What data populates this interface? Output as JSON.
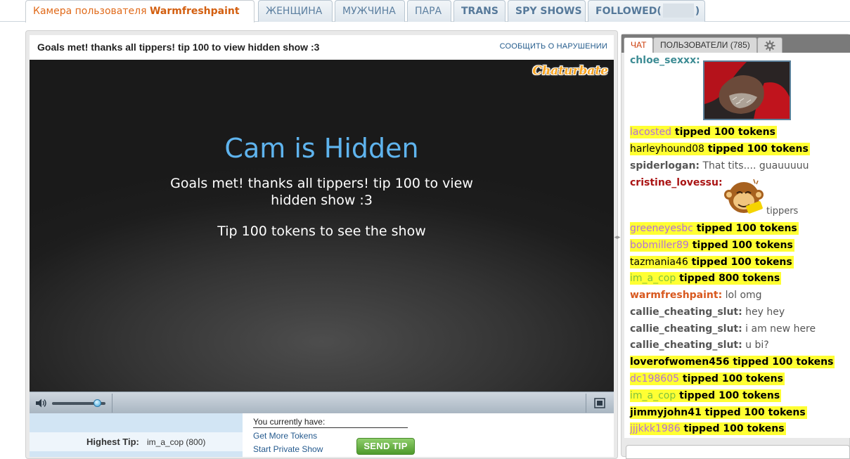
{
  "tabs": {
    "cam_prefix": "Камера пользователя",
    "cam_user": "Warmfreshpaint",
    "female": "ЖЕНЩИНА",
    "male": "МУЖЧИНА",
    "couple": "ПАРА",
    "trans": "TRANS",
    "spy": "SPY SHOWS",
    "followed_prefix": "FOLLOWED(",
    "followed_suffix": ")"
  },
  "room": {
    "subject": "Goals met! thanks all tippers! tip 100 to view hidden show :3",
    "report_link": "СООБЩИТЬ О НАРУШЕНИИ"
  },
  "video": {
    "logo": "Chaturbate",
    "hidden_title": "Cam is Hidden",
    "hidden_message": "Goals met! thanks all tippers! tip 100 to view hidden show :3",
    "tip_prompt": "Tip 100 tokens to see the show",
    "volume_level": 0.85
  },
  "info": {
    "highest_tip_label": "Highest Tip:",
    "highest_tip_value": "im_a_cop (800)"
  },
  "tip": {
    "balance_label": "You currently have:",
    "get_more": "Get More Tokens",
    "private_show": "Start Private Show",
    "send_tip": "SEND TIP"
  },
  "chat": {
    "tab_chat": "ЧАТ",
    "tab_users": "ПОЛЬЗОВАТЕЛИ (785)",
    "partial_user": "chloe_sexxx:",
    "emote_user": "cristine_lovessu:",
    "emote_caption": "tippers",
    "messages": [
      {
        "user": "lacosted",
        "text": "tipped 100 tokens"
      },
      {
        "user": "harleyhound08",
        "text": "tipped 100 tokens"
      },
      {
        "user": "spiderlogan:",
        "text": "That tits.... guauuuuu"
      },
      {
        "user": "greeneyesbc",
        "text": "tipped 100 tokens"
      },
      {
        "user": "bobmiller89",
        "text": "tipped 100 tokens"
      },
      {
        "user": "tazmania46",
        "text": "tipped 100 tokens"
      },
      {
        "user": "im_a_cop",
        "text": "tipped 800 tokens"
      },
      {
        "user": "warmfreshpaint:",
        "text": "lol omg"
      },
      {
        "user": "callie_cheating_slut:",
        "text": "hey hey"
      },
      {
        "user": "callie_cheating_slut:",
        "text": "i am new here"
      },
      {
        "user": "callie_cheating_slut:",
        "text": "u bi?"
      },
      {
        "user": "loverofwomen456",
        "text": "tipped 100 tokens"
      },
      {
        "user": "dc198605",
        "text": "tipped 100 tokens"
      },
      {
        "user": "im_a_cop",
        "text": "tipped 100 tokens"
      },
      {
        "user": "jimmyjohn41",
        "text": "tipped 100 tokens"
      },
      {
        "user": "jjjkkk1986",
        "text": "tipped 100 tokens"
      }
    ]
  },
  "colors": {
    "tip_highlight": "#ffff33",
    "accent_orange": "#d35f10",
    "hidden_title": "#5fb4ee",
    "link_blue": "#255a8e"
  }
}
